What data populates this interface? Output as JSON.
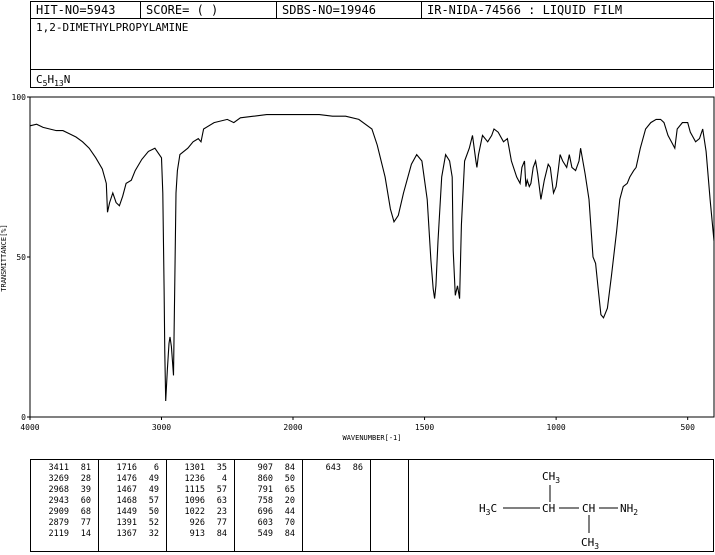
{
  "header": {
    "hit_no": "HIT-NO=5943",
    "score": "SCORE=  (   )",
    "sdbs_no": "SDBS-NO=19946",
    "ir": "IR-NIDA-74566 : LIQUID FILM"
  },
  "compound": {
    "name": "1,2-DIMETHYLPROPYLAMINE",
    "formula_main": "C",
    "formula_c": "5",
    "formula_h_letter": "H",
    "formula_h": "13",
    "formula_tail": "N"
  },
  "chart_data": {
    "type": "line",
    "xlabel": "WAVENUMBER[-1]",
    "ylabel": "TRANSMITTANCE[%]",
    "xlim": [
      4000,
      400
    ],
    "ylim": [
      0,
      100
    ],
    "x_ticks": [
      4000,
      3000,
      2000,
      1500,
      1000,
      500
    ],
    "y_ticks": [
      0,
      50,
      100
    ],
    "series": [
      {
        "points": [
          [
            4000,
            91
          ],
          [
            3950,
            91.5
          ],
          [
            3900,
            90.5
          ],
          [
            3850,
            90
          ],
          [
            3800,
            89.5
          ],
          [
            3750,
            89.5
          ],
          [
            3700,
            88.5
          ],
          [
            3650,
            87.5
          ],
          [
            3600,
            86
          ],
          [
            3550,
            84
          ],
          [
            3500,
            81
          ],
          [
            3450,
            77.5
          ],
          [
            3420,
            73
          ],
          [
            3411,
            64
          ],
          [
            3395,
            67
          ],
          [
            3370,
            70
          ],
          [
            3345,
            67
          ],
          [
            3320,
            66
          ],
          [
            3295,
            69
          ],
          [
            3269,
            73
          ],
          [
            3230,
            74
          ],
          [
            3200,
            77
          ],
          [
            3150,
            80.5
          ],
          [
            3100,
            83
          ],
          [
            3050,
            84
          ],
          [
            3000,
            81
          ],
          [
            2990,
            70
          ],
          [
            2980,
            40
          ],
          [
            2975,
            20
          ],
          [
            2968,
            5
          ],
          [
            2955,
            15
          ],
          [
            2943,
            23
          ],
          [
            2935,
            25
          ],
          [
            2925,
            22
          ],
          [
            2909,
            13
          ],
          [
            2900,
            40
          ],
          [
            2890,
            70
          ],
          [
            2879,
            77
          ],
          [
            2860,
            82
          ],
          [
            2800,
            84
          ],
          [
            2760,
            86
          ],
          [
            2720,
            87
          ],
          [
            2700,
            86
          ],
          [
            2680,
            90
          ],
          [
            2600,
            92
          ],
          [
            2500,
            93
          ],
          [
            2450,
            92
          ],
          [
            2400,
            93.5
          ],
          [
            2300,
            94
          ],
          [
            2200,
            94.5
          ],
          [
            2100,
            94.5
          ],
          [
            2000,
            94.5
          ],
          [
            1900,
            94.5
          ],
          [
            1850,
            94
          ],
          [
            1800,
            94
          ],
          [
            1750,
            93
          ],
          [
            1700,
            90
          ],
          [
            1680,
            85
          ],
          [
            1650,
            75
          ],
          [
            1630,
            65
          ],
          [
            1616,
            61
          ],
          [
            1600,
            63
          ],
          [
            1580,
            70
          ],
          [
            1550,
            79
          ],
          [
            1530,
            82
          ],
          [
            1510,
            80
          ],
          [
            1490,
            68
          ],
          [
            1476,
            49
          ],
          [
            1467,
            40
          ],
          [
            1462,
            37
          ],
          [
            1457,
            41
          ],
          [
            1449,
            55
          ],
          [
            1435,
            75
          ],
          [
            1420,
            82
          ],
          [
            1405,
            80
          ],
          [
            1395,
            75
          ],
          [
            1391,
            52
          ],
          [
            1383,
            38
          ],
          [
            1375,
            41
          ],
          [
            1367,
            37
          ],
          [
            1360,
            60
          ],
          [
            1348,
            80
          ],
          [
            1330,
            84
          ],
          [
            1318,
            88
          ],
          [
            1305,
            80
          ],
          [
            1301,
            78
          ],
          [
            1295,
            82
          ],
          [
            1280,
            88
          ],
          [
            1260,
            86
          ],
          [
            1245,
            88
          ],
          [
            1236,
            90
          ],
          [
            1220,
            89
          ],
          [
            1200,
            86
          ],
          [
            1185,
            87
          ],
          [
            1170,
            80
          ],
          [
            1150,
            75
          ],
          [
            1137,
            73
          ],
          [
            1130,
            78
          ],
          [
            1120,
            80
          ],
          [
            1115,
            72
          ],
          [
            1110,
            74
          ],
          [
            1102,
            72
          ],
          [
            1096,
            73
          ],
          [
            1087,
            78
          ],
          [
            1078,
            80
          ],
          [
            1070,
            76
          ],
          [
            1058,
            68
          ],
          [
            1045,
            74
          ],
          [
            1030,
            79
          ],
          [
            1022,
            78
          ],
          [
            1010,
            70
          ],
          [
            1000,
            72
          ],
          [
            992,
            77
          ],
          [
            985,
            82
          ],
          [
            975,
            80
          ],
          [
            960,
            78
          ],
          [
            950,
            82
          ],
          [
            940,
            78
          ],
          [
            926,
            77
          ],
          [
            913,
            80
          ],
          [
            907,
            84
          ],
          [
            890,
            76
          ],
          [
            875,
            68
          ],
          [
            860,
            50
          ],
          [
            850,
            48
          ],
          [
            840,
            40
          ],
          [
            830,
            32
          ],
          [
            820,
            31
          ],
          [
            805,
            34
          ],
          [
            790,
            44
          ],
          [
            770,
            58
          ],
          [
            758,
            68
          ],
          [
            745,
            72
          ],
          [
            730,
            73
          ],
          [
            720,
            75
          ],
          [
            705,
            77
          ],
          [
            696,
            78
          ],
          [
            680,
            84
          ],
          [
            660,
            90
          ],
          [
            640,
            92
          ],
          [
            620,
            93
          ],
          [
            603,
            93
          ],
          [
            590,
            92
          ],
          [
            575,
            88
          ],
          [
            562,
            86
          ],
          [
            549,
            84
          ],
          [
            540,
            90
          ],
          [
            520,
            92
          ],
          [
            500,
            92
          ],
          [
            490,
            89
          ],
          [
            470,
            86
          ],
          [
            455,
            87
          ],
          [
            443,
            90
          ],
          [
            430,
            83
          ],
          [
            415,
            68
          ],
          [
            400,
            55
          ]
        ]
      }
    ]
  },
  "peak_table": [
    {
      "w": "3411",
      "t": "81"
    },
    {
      "w": "3269",
      "t": "28"
    },
    {
      "w": "2968",
      "t": "39"
    },
    {
      "w": "2943",
      "t": "60"
    },
    {
      "w": "2909",
      "t": "68"
    },
    {
      "w": "2879",
      "t": "77"
    },
    {
      "w": "2119",
      "t": "14"
    },
    {
      "w": "1716",
      "t": "6"
    },
    {
      "w": "1476",
      "t": "49"
    },
    {
      "w": "1467",
      "t": "49"
    },
    {
      "w": "1468",
      "t": "57"
    },
    {
      "w": "1449",
      "t": "50"
    },
    {
      "w": "1391",
      "t": "52"
    },
    {
      "w": "1367",
      "t": "32"
    },
    {
      "w": "1301",
      "t": "35"
    },
    {
      "w": "1236",
      "t": "4"
    },
    {
      "w": "1115",
      "t": "57"
    },
    {
      "w": "1096",
      "t": "63"
    },
    {
      "w": "1022",
      "t": "23"
    },
    {
      "w": "926",
      "t": "77"
    },
    {
      "w": "913",
      "t": "84"
    },
    {
      "w": "907",
      "t": "84"
    },
    {
      "w": "860",
      "t": "50"
    },
    {
      "w": "791",
      "t": "65"
    },
    {
      "w": "758",
      "t": "20"
    },
    {
      "w": "696",
      "t": "44"
    },
    {
      "w": "603",
      "t": "70"
    },
    {
      "w": "549",
      "t": "84"
    },
    {
      "w": "643",
      "t": "86"
    }
  ],
  "structure": {
    "top_methyl": "CH3",
    "left": "H3C",
    "center1": "CH",
    "center2": "CH",
    "amine": "NH2",
    "bottom_methyl": "CH3"
  }
}
